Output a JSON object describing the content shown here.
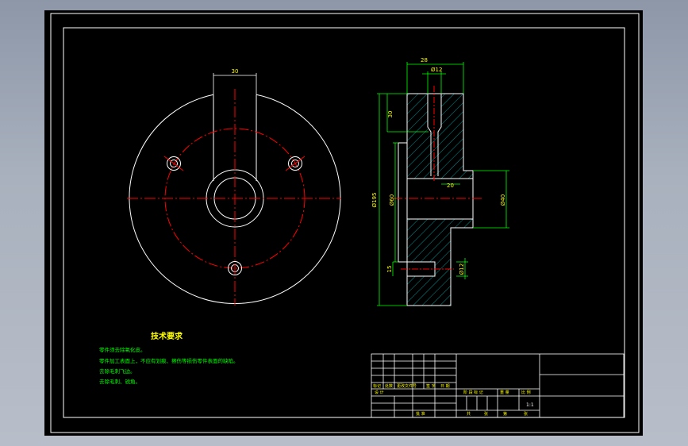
{
  "colors": {
    "background": "#000000",
    "outline": "#ffffff",
    "center_line": "#ff0000",
    "dimension": "#00ff00",
    "hatch": "#00a0a0",
    "title_text": "#ffff00",
    "body_text": "#00ff00"
  },
  "dimensions": {
    "slot_width": "30",
    "hub_length": "28",
    "hole_diameter_top": "Ø12",
    "top_height": "30",
    "overall_height": "Ø195",
    "body_diameter": "Ø60",
    "bore_depth": "20",
    "hub_diameter": "Ø40",
    "bottom_step": "15",
    "hole_diameter_bottom": "Ø12"
  },
  "tech_requirements": {
    "title": "技术要求",
    "lines": [
      "零件须去除氧化皮。",
      "零件加工表面上，不应有划痕、擦伤等损伤零件表面的缺陷。",
      "去除毛刺飞边。",
      "去除毛刺、锐角。"
    ]
  },
  "title_block": {
    "row_labels": [
      "标记",
      "处数",
      "更改文件号",
      "签 字",
      "日 期"
    ],
    "designer_label": "设 计",
    "stage_labels": [
      "阶 段 标 记",
      "重 量",
      "比 例"
    ],
    "scale_value": "1:1",
    "approve_label": "批 准",
    "sheet_labels": [
      "共",
      "张",
      "第",
      "张"
    ]
  }
}
